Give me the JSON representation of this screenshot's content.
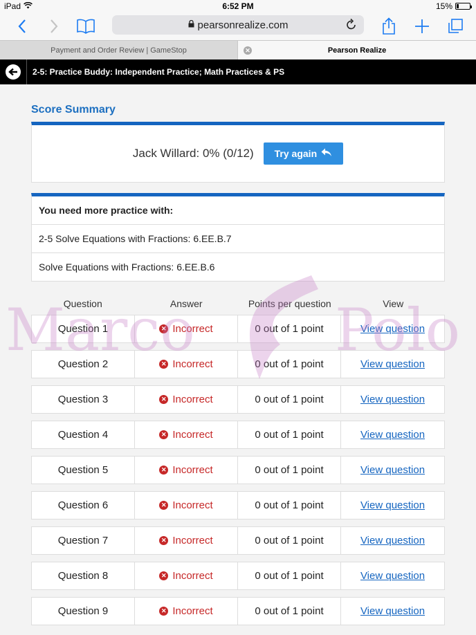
{
  "status_bar": {
    "device": "iPad",
    "time": "6:52 PM",
    "battery": "15%",
    "battery_level": 0.15
  },
  "browser": {
    "address": "pearsonrealize.com",
    "tabs": [
      {
        "label": "Payment and Order Review | GameStop",
        "active": false
      },
      {
        "label": "Pearson Realize",
        "active": true
      }
    ],
    "accent_color": "#1d7cf2"
  },
  "header": {
    "title": "2-5: Practice Buddy: Independent Practice; Math Practices & PS"
  },
  "score_summary": {
    "title": "Score Summary",
    "student_score": "Jack Willard: 0% (0/12)",
    "try_again_label": "Try again"
  },
  "practice": {
    "heading": "You need more practice with:",
    "items": [
      "2-5 Solve Equations with Fractions: 6.EE.B.7",
      "Solve Equations with Fractions: 6.EE.B.6"
    ]
  },
  "results": {
    "columns": [
      "Question",
      "Answer",
      "Points per question",
      "View"
    ],
    "rows": [
      {
        "question": "Question 1",
        "answer": "Incorrect",
        "points": "0 out of 1 point",
        "view": "View question"
      },
      {
        "question": "Question 2",
        "answer": "Incorrect",
        "points": "0 out of 1 point",
        "view": "View question"
      },
      {
        "question": "Question 3",
        "answer": "Incorrect",
        "points": "0 out of 1 point",
        "view": "View question"
      },
      {
        "question": "Question 4",
        "answer": "Incorrect",
        "points": "0 out of 1 point",
        "view": "View question"
      },
      {
        "question": "Question 5",
        "answer": "Incorrect",
        "points": "0 out of 1 point",
        "view": "View question"
      },
      {
        "question": "Question 6",
        "answer": "Incorrect",
        "points": "0 out of 1 point",
        "view": "View question"
      },
      {
        "question": "Question 7",
        "answer": "Incorrect",
        "points": "0 out of 1 point",
        "view": "View question"
      },
      {
        "question": "Question 8",
        "answer": "Incorrect",
        "points": "0 out of 1 point",
        "view": "View question"
      },
      {
        "question": "Question 9",
        "answer": "Incorrect",
        "points": "0 out of 1 point",
        "view": "View question"
      }
    ]
  },
  "watermark": {
    "left": "Marco",
    "right": "Polo"
  },
  "colors": {
    "brand_blue": "#1565c0",
    "incorrect_red": "#c62828",
    "button_blue": "#2f8fe0"
  }
}
